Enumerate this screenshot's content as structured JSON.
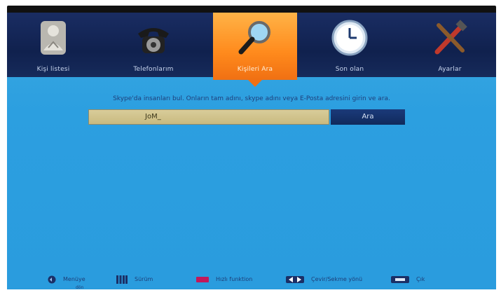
{
  "tabs": [
    {
      "label": "Kişi listesi",
      "icon": "contact-person-icon"
    },
    {
      "label": "Telefonlarım",
      "icon": "telephone-icon"
    },
    {
      "label": "Kişileri Ara",
      "icon": "search-icon",
      "active": true
    },
    {
      "label": "Son olan",
      "icon": "clock-icon"
    },
    {
      "label": "Ayarlar",
      "icon": "tools-icon"
    }
  ],
  "search": {
    "prompt": "Skype'da insanları bul. Onların tam adını, skype adını veya E-Posta adresini girin ve ara.",
    "value": "JoM_",
    "button_label": "Ara"
  },
  "hints": [
    {
      "label": "Menüye",
      "sub": "dön",
      "icon": "back-button-icon"
    },
    {
      "label": "Sürüm",
      "icon": "numeric-keypad-icon"
    },
    {
      "label": "Hızlı funktion",
      "icon": "red-button-icon"
    },
    {
      "label": "Çevir/Sekme yönü",
      "icon": "left-right-arrows-icon"
    },
    {
      "label": "Çık",
      "icon": "exit-button-icon"
    }
  ],
  "colors": {
    "accent": "#ff8a1c",
    "topbar": "#10214e",
    "background": "#2c9fe0"
  }
}
